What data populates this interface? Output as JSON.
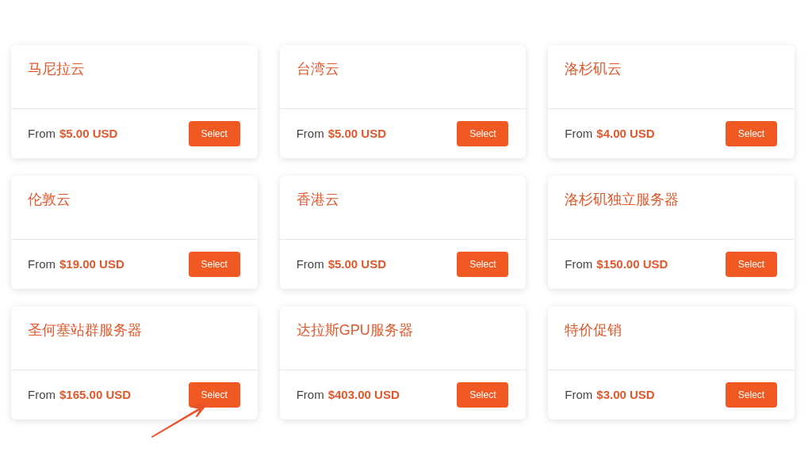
{
  "products": [
    {
      "name": "马尼拉云",
      "from": "From",
      "price": "$5.00 USD",
      "button": "Select"
    },
    {
      "name": "台湾云",
      "from": "From",
      "price": "$5.00 USD",
      "button": "Select"
    },
    {
      "name": "洛杉矶云",
      "from": "From",
      "price": "$4.00 USD",
      "button": "Select"
    },
    {
      "name": "伦敦云",
      "from": "From",
      "price": "$19.00 USD",
      "button": "Select"
    },
    {
      "name": "香港云",
      "from": "From",
      "price": "$5.00 USD",
      "button": "Select"
    },
    {
      "name": "洛杉矶独立服务器",
      "from": "From",
      "price": "$150.00 USD",
      "button": "Select"
    },
    {
      "name": "圣何塞站群服务器",
      "from": "From",
      "price": "$165.00 USD",
      "button": "Select"
    },
    {
      "name": "达拉斯GPU服务器",
      "from": "From",
      "price": "$403.00 USD",
      "button": "Select"
    },
    {
      "name": "特价促销",
      "from": "From",
      "price": "$3.00 USD",
      "button": "Select"
    }
  ]
}
